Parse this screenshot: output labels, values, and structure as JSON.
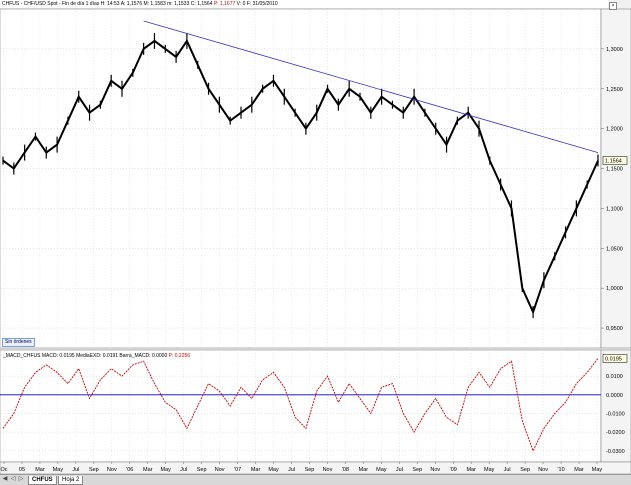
{
  "window": {
    "title_prefix": "CHFUS - CHF/USD Spot - Fin de día 1 días",
    "h": "H: 14:53",
    "a": "A: 1,1576",
    "m": "M: 1,1583",
    "m2": "m: 1,1533",
    "c": "C: 1,1564",
    "p": "P: 1,1677",
    "v": "V: 0",
    "f": "F: 31/05/2010",
    "close_glyph": "×"
  },
  "price_panel": {
    "last_price_label": "1,1564",
    "button_label": "Sin órdenes",
    "colors": {
      "price": "#000000",
      "trendline": "#3333cc",
      "background": "#ffffff"
    }
  },
  "macd_panel": {
    "header": {
      "name": "_MACD_CHFUS",
      "macd": "MACD: 0.0195",
      "media": "MediaEXD: 0.0191",
      "barra": "Barra_MACD: 0.0000",
      "p": "P: 0.2256"
    },
    "last_value_label": "0.0195",
    "colors": {
      "macd": "#cc0000",
      "zero_line": "#0000cc"
    }
  },
  "bottom_bar": {
    "tab_active": "CHFUS",
    "tab_other": "Hoja 2"
  },
  "chart_data": [
    {
      "type": "line",
      "title": "CHFUS - CHF/USD Spot",
      "x": [
        "2005-10",
        "2005-11",
        "2005-12",
        "2006-01",
        "2006-02",
        "2006-03",
        "2006-04",
        "2006-05",
        "2006-06",
        "2006-07",
        "2006-08",
        "2006-09",
        "2006-10",
        "2006-11",
        "2006-12",
        "2007-01",
        "2007-02",
        "2007-03",
        "2007-04",
        "2007-05",
        "2007-06",
        "2007-07",
        "2007-08",
        "2007-09",
        "2007-10",
        "2007-11",
        "2007-12",
        "2008-01",
        "2008-02",
        "2008-03",
        "2008-04",
        "2008-05",
        "2008-06",
        "2008-07",
        "2008-08",
        "2008-09",
        "2008-10",
        "2008-11",
        "2008-12",
        "2009-01",
        "2009-02",
        "2009-03",
        "2009-04",
        "2009-05",
        "2009-06",
        "2009-07",
        "2009-08",
        "2009-09",
        "2009-10",
        "2009-11",
        "2009-12",
        "2010-01",
        "2010-02",
        "2010-03",
        "2010-04",
        "2010-05"
      ],
      "series": [
        {
          "name": "CHFUS",
          "values": [
            1.16,
            1.15,
            1.17,
            1.19,
            1.17,
            1.18,
            1.21,
            1.24,
            1.22,
            1.23,
            1.26,
            1.25,
            1.27,
            1.3,
            1.31,
            1.3,
            1.29,
            1.31,
            1.28,
            1.25,
            1.23,
            1.21,
            1.22,
            1.23,
            1.25,
            1.26,
            1.24,
            1.22,
            1.2,
            1.22,
            1.25,
            1.23,
            1.25,
            1.24,
            1.22,
            1.24,
            1.23,
            1.22,
            1.24,
            1.22,
            1.2,
            1.18,
            1.21,
            1.22,
            1.2,
            1.16,
            1.13,
            1.1,
            1.0,
            0.97,
            1.01,
            1.04,
            1.07,
            1.1,
            1.13,
            1.16
          ]
        }
      ],
      "trendline": {
        "start": [
          "2006-11",
          1.335
        ],
        "end": [
          "2010-05",
          1.17
        ]
      },
      "y_ticks": [
        "0,9500",
        "1,0000",
        "1,0500",
        "1,1000",
        "1,1500",
        "1,2000",
        "1,2500",
        "1,3000"
      ],
      "ylim": [
        0.925,
        1.35
      ],
      "grid": true
    },
    {
      "type": "line",
      "title": "_MACD_CHFUS",
      "series": [
        {
          "name": "MACD",
          "values": [
            -0.018,
            -0.01,
            0.004,
            0.012,
            0.016,
            0.012,
            0.006,
            0.014,
            -0.002,
            0.008,
            0.014,
            0.01,
            0.016,
            0.018,
            0.006,
            -0.004,
            -0.008,
            -0.018,
            -0.006,
            0.006,
            0.002,
            -0.006,
            0.004,
            -0.002,
            0.008,
            0.012,
            0.004,
            -0.012,
            -0.018,
            0.002,
            0.01,
            -0.004,
            0.006,
            -0.002,
            -0.01,
            0.004,
            0.006,
            -0.01,
            -0.02,
            -0.01,
            -0.002,
            -0.012,
            -0.016,
            0.004,
            0.012,
            0.004,
            0.014,
            0.018,
            -0.014,
            -0.03,
            -0.018,
            -0.01,
            -0.004,
            0.006,
            0.012,
            0.0195
          ]
        }
      ],
      "y_ticks": [
        "0.0100",
        "0.0000",
        "-0.0100",
        "-0.0200",
        "-0.0300"
      ],
      "ylim": [
        -0.036,
        0.024
      ],
      "grid": true
    }
  ],
  "x_axis_labels": [
    "Oc",
    "05",
    "Mar",
    "May",
    "Jul",
    "Sep",
    "Nov",
    "'06",
    "Mar",
    "May",
    "Jul",
    "Sep",
    "Nov",
    "'07",
    "Mar",
    "May",
    "Jul",
    "Sep",
    "Nov",
    "'08",
    "Mar",
    "May",
    "Jul",
    "Sep",
    "Nov",
    "'09",
    "Mar",
    "May",
    "Jul",
    "Sep",
    "Nov",
    "'10",
    "Mar",
    "May"
  ]
}
